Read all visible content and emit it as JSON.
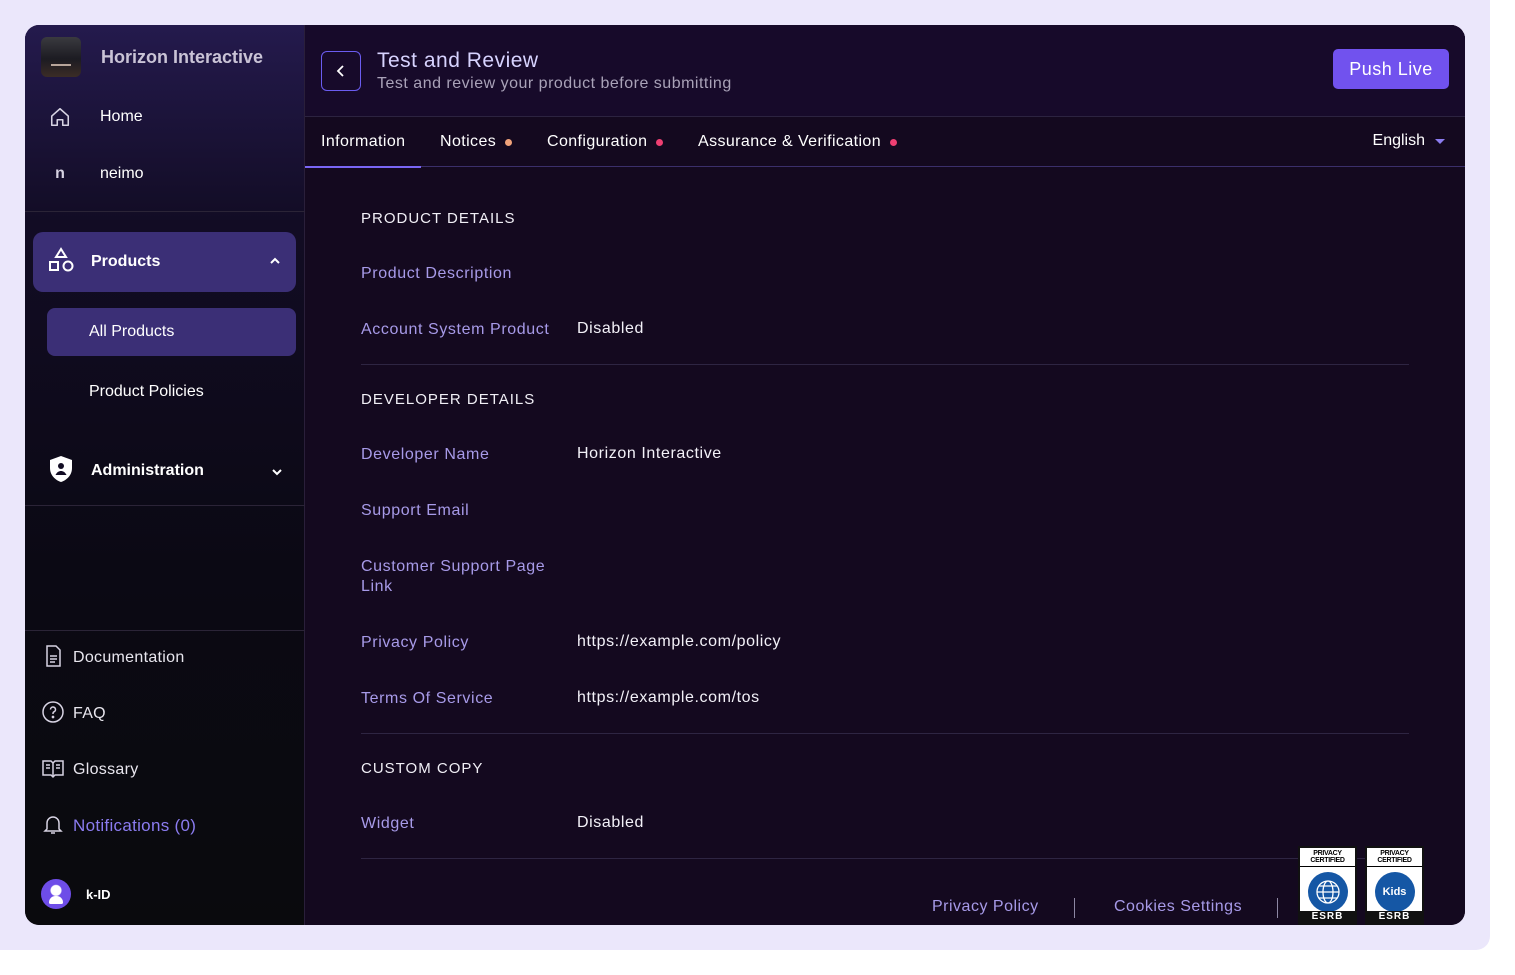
{
  "app": {
    "brand_name": "Horizon Interactive",
    "accent_color": "#7152ee"
  },
  "sidebar": {
    "nav": [
      {
        "label": "Home",
        "icon": "home-icon"
      },
      {
        "label": "neimo",
        "icon": "n-initial-icon",
        "initial": "n"
      }
    ],
    "products": {
      "label": "Products",
      "icon": "shapes-icon",
      "expanded": true
    },
    "product_items": [
      {
        "label": "All Products",
        "active": true
      },
      {
        "label": "Product Policies",
        "active": false
      }
    ],
    "administration": {
      "label": "Administration",
      "icon": "shield-icon",
      "expanded": false
    },
    "bottom": [
      {
        "label": "Documentation",
        "icon": "document-icon"
      },
      {
        "label": "FAQ",
        "icon": "question-circle-icon"
      },
      {
        "label": "Glossary",
        "icon": "book-icon"
      },
      {
        "label": "Notifications (0)",
        "icon": "bell-icon"
      }
    ],
    "user": {
      "name": "k-ID"
    }
  },
  "header": {
    "title": "Test and Review",
    "subtitle": "Test and review your product before submitting",
    "push_label": "Push Live"
  },
  "tabs": [
    {
      "label": "Information",
      "active": true,
      "dot": null
    },
    {
      "label": "Notices",
      "active": false,
      "dot": "#f0a27a"
    },
    {
      "label": "Configuration",
      "active": false,
      "dot": "#ef3f72"
    },
    {
      "label": "Assurance & Verification",
      "active": false,
      "dot": "#ef3f72"
    }
  ],
  "language": "English",
  "sections": {
    "product": {
      "title": "PRODUCT DETAILS",
      "fields": [
        {
          "label": "Product Description",
          "value": ""
        },
        {
          "label": "Account System Product",
          "value": "Disabled"
        }
      ]
    },
    "developer": {
      "title": "DEVELOPER DETAILS",
      "fields": [
        {
          "label": "Developer Name",
          "value": "Horizon Interactive"
        },
        {
          "label": "Support Email",
          "value": ""
        },
        {
          "label": "Customer Support Page Link",
          "value": ""
        },
        {
          "label": "Privacy Policy",
          "value": "https://example.com/policy"
        },
        {
          "label": "Terms Of Service",
          "value": "https://example.com/tos"
        }
      ]
    },
    "custom": {
      "title": "CUSTOM COPY",
      "fields": [
        {
          "label": "Widget",
          "value": "Disabled"
        }
      ]
    }
  },
  "footer": {
    "links": [
      "Privacy Policy",
      "Cookies Settings"
    ],
    "badges": [
      {
        "top": "PRIVACY CERTIFIED",
        "seal": "",
        "bottom": "ESRB"
      },
      {
        "top": "PRIVACY CERTIFIED",
        "seal": "Kids",
        "bottom": "ESRB"
      }
    ]
  }
}
